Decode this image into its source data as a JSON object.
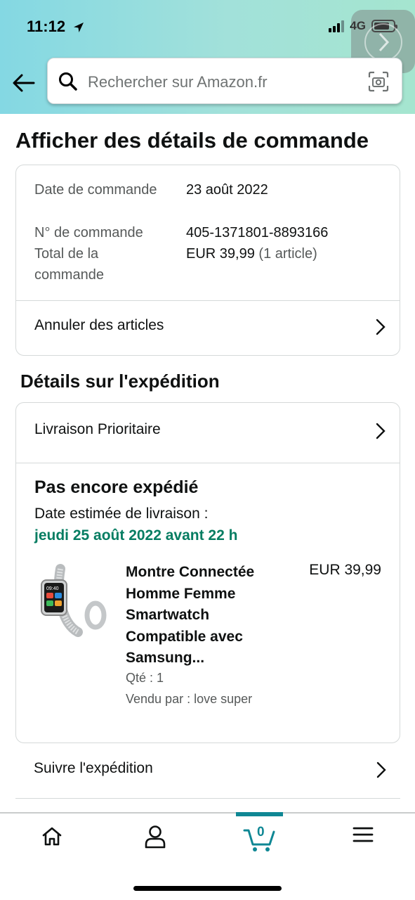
{
  "status": {
    "time": "11:12",
    "network": "4G",
    "battery_level": 0.8
  },
  "colors": {
    "accent": "#0f8794",
    "green": "#067d62",
    "muted": "#565959"
  },
  "search": {
    "placeholder": "Rechercher sur Amazon.fr"
  },
  "page": {
    "title": "Afficher des détails de commande"
  },
  "order": {
    "date_label": "Date de commande",
    "date_value": "23 août 2022",
    "number_label": "N° de commande",
    "number_value": "405-1371801-8893166",
    "total_label": "Total de la commande",
    "total_value": "EUR 39,99",
    "total_items": "(1 article)",
    "cancel_label": "Annuler des articles"
  },
  "shipping": {
    "section_title": "Détails sur l'expédition",
    "method": "Livraison Prioritaire",
    "status": "Pas encore expédié",
    "eta_label": "Date estimée de livraison :",
    "eta_date": "jeudi 25 août 2022 avant 22 h",
    "product": {
      "title": "Montre Connectée Homme Femme Smartwatch Compatible avec Samsung...",
      "price": "EUR 39,99",
      "qty": "Qté : 1",
      "seller": "Vendu par : love super"
    },
    "track_label": "Suivre l'expédition"
  },
  "tabbar": {
    "items": [
      {
        "icon": "home-icon"
      },
      {
        "icon": "user-icon"
      },
      {
        "icon": "cart-icon",
        "count": "0",
        "selected": true
      },
      {
        "icon": "menu-icon"
      }
    ]
  }
}
